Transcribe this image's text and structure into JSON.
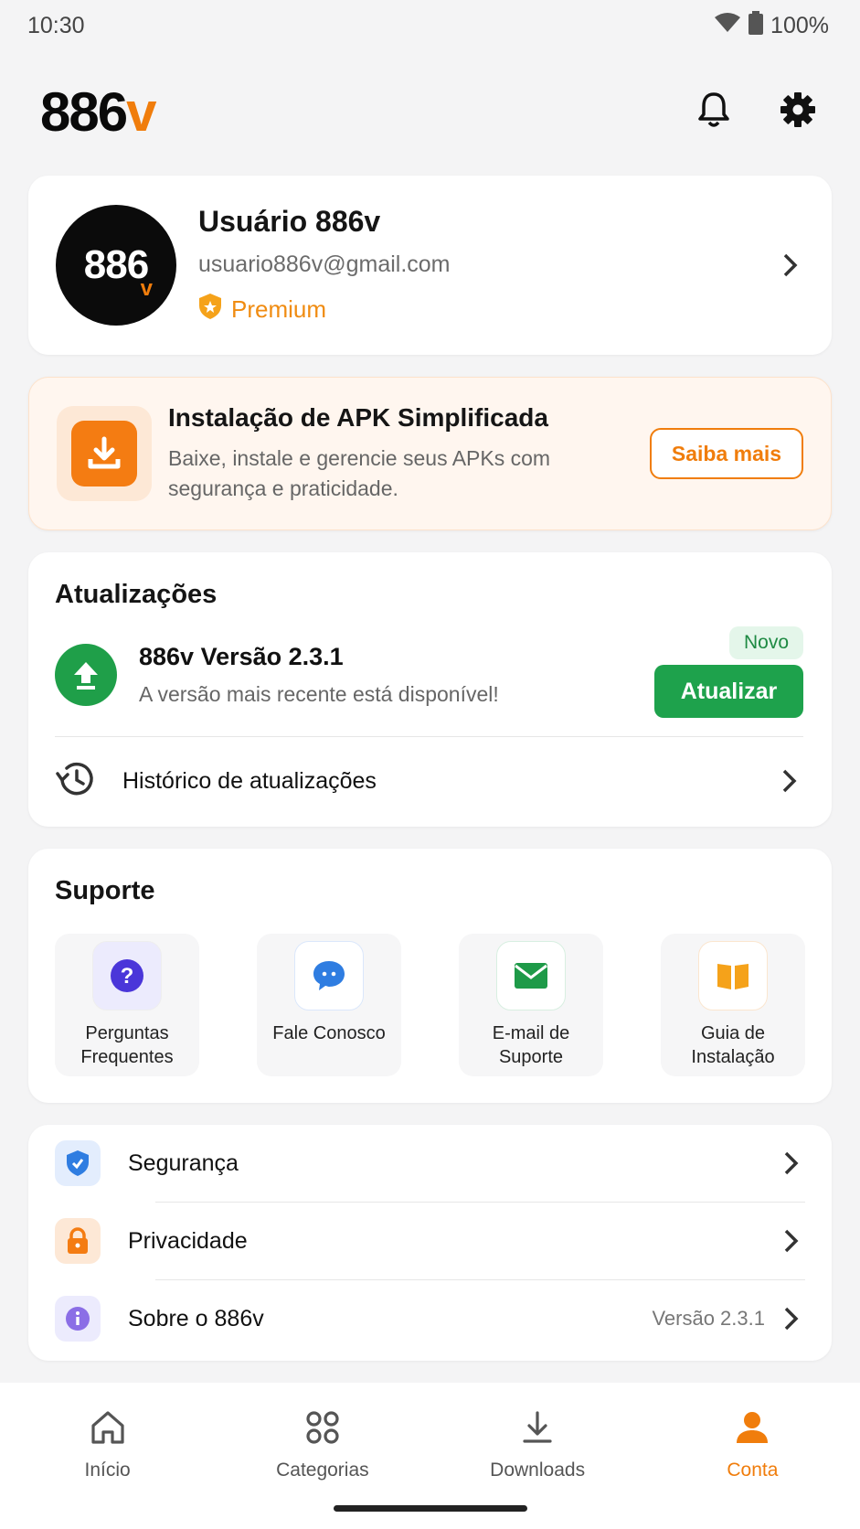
{
  "status": {
    "time": "10:30",
    "battery": "100%"
  },
  "header": {
    "logo_main": "886",
    "logo_accent": "v"
  },
  "profile": {
    "avatar_text": "886",
    "avatar_accent": "v",
    "name": "Usuário 886v",
    "email": "usuario886v@gmail.com",
    "badge": "Premium"
  },
  "promo": {
    "title": "Instalação de APK Simplificada",
    "description": "Baixe, instale e gerencie seus APKs com segurança e praticidade.",
    "button": "Saiba mais"
  },
  "updates": {
    "title": "Atualizações",
    "item_title": "886v Versão 2.3.1",
    "item_desc": "A versão mais recente está disponível!",
    "badge": "Novo",
    "button": "Atualizar",
    "history": "Histórico de atualizações"
  },
  "support": {
    "title": "Suporte",
    "items": [
      {
        "label": "Perguntas Frequentes",
        "icon": "question-icon"
      },
      {
        "label": "Fale Conosco",
        "icon": "chat-icon"
      },
      {
        "label": "E-mail de Suporte",
        "icon": "mail-icon"
      },
      {
        "label": "Guia de Instalação",
        "icon": "book-icon"
      }
    ]
  },
  "settings": {
    "items": [
      {
        "label": "Segurança",
        "icon": "shield-icon"
      },
      {
        "label": "Privacidade",
        "icon": "lock-icon"
      },
      {
        "label": "Sobre o 886v",
        "icon": "info-icon",
        "value": "Versão 2.3.1"
      }
    ]
  },
  "nav": {
    "items": [
      {
        "label": "Início",
        "icon": "home-icon"
      },
      {
        "label": "Categorias",
        "icon": "grid-icon"
      },
      {
        "label": "Downloads",
        "icon": "download-icon"
      },
      {
        "label": "Conta",
        "icon": "person-icon"
      }
    ],
    "active": "Conta"
  },
  "colors": {
    "accent": "#f07d0c",
    "green": "#1ea24c",
    "text": "#151515"
  }
}
